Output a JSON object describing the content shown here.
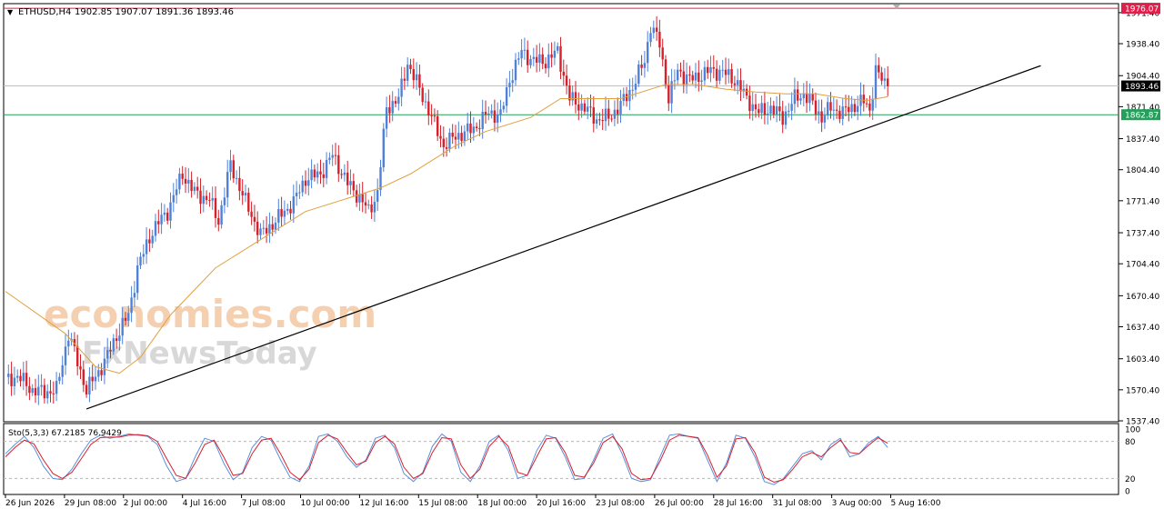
{
  "header": {
    "symbol_label": "ETHUSD,H4",
    "ohlc_text": "1902.85 1907.07 1891.36 1893.46",
    "dropdown_glyph": "▼"
  },
  "watermark": {
    "line1": "economies.com",
    "line2": "FxNewsToday"
  },
  "colors": {
    "bull": "#4f81d9",
    "bear": "#d6202a",
    "ma": "#e0a040",
    "trendline": "#000000",
    "resistance": "#e0204a",
    "support": "#23a05a",
    "current_price_bg": "#000000",
    "stoch_main": "#5b8fd8",
    "stoch_signal": "#d62030"
  },
  "chart_data": [
    {
      "type": "candlestick",
      "symbol": "ETHUSD",
      "timeframe": "H4",
      "y_ticks": [
        1971.4,
        1938.4,
        1904.4,
        1871.4,
        1837.4,
        1804.4,
        1771.4,
        1737.4,
        1704.4,
        1670.4,
        1637.4,
        1603.4,
        1570.4,
        1537.4
      ],
      "ylim": [
        1537.4,
        1980
      ],
      "x_ticks": [
        "26 Jun 2026",
        "29 Jun 08:00",
        "2 Jul 00:00",
        "4 Jul 16:00",
        "7 Jul 08:00",
        "10 Jul 00:00",
        "12 Jul 16:00",
        "15 Jul 08:00",
        "18 Jul 00:00",
        "20 Jul 16:00",
        "23 Jul 08:00",
        "26 Jul 00:00",
        "28 Jul 16:00",
        "31 Jul 08:00",
        "3 Aug 00:00",
        "5 Aug 16:00"
      ],
      "bar_count": 240,
      "anchors": [
        [
          0,
          1580
        ],
        [
          4,
          1585
        ],
        [
          9,
          1570
        ],
        [
          13,
          1568
        ],
        [
          17,
          1570
        ],
        [
          21,
          1630
        ],
        [
          24,
          1600
        ],
        [
          27,
          1570
        ],
        [
          30,
          1585
        ],
        [
          33,
          1600
        ],
        [
          37,
          1628
        ],
        [
          41,
          1650
        ],
        [
          44,
          1700
        ],
        [
          49,
          1740
        ],
        [
          54,
          1760
        ],
        [
          59,
          1800
        ],
        [
          63,
          1780
        ],
        [
          68,
          1772
        ],
        [
          71,
          1750
        ],
        [
          75,
          1810
        ],
        [
          80,
          1770
        ],
        [
          85,
          1735
        ],
        [
          90,
          1750
        ],
        [
          96,
          1770
        ],
        [
          100,
          1795
        ],
        [
          105,
          1800
        ],
        [
          109,
          1820
        ],
        [
          114,
          1790
        ],
        [
          118,
          1775
        ],
        [
          121,
          1760
        ],
        [
          124,
          1780
        ],
        [
          127,
          1870
        ],
        [
          131,
          1880
        ],
        [
          134,
          1918
        ],
        [
          138,
          1890
        ],
        [
          142,
          1860
        ],
        [
          146,
          1830
        ],
        [
          150,
          1840
        ],
        [
          156,
          1848
        ],
        [
          161,
          1865
        ],
        [
          165,
          1862
        ],
        [
          168,
          1900
        ],
        [
          172,
          1930
        ],
        [
          176,
          1920
        ],
        [
          180,
          1920
        ],
        [
          184,
          1930
        ],
        [
          188,
          1880
        ],
        [
          193,
          1870
        ],
        [
          197,
          1858
        ],
        [
          201,
          1860
        ],
        [
          205,
          1873
        ],
        [
          209,
          1893
        ],
        [
          213,
          1920
        ],
        [
          215,
          1958
        ],
        [
          218,
          1938
        ],
        [
          221,
          1880
        ],
        [
          224,
          1910
        ],
        [
          228,
          1900
        ],
        [
          232,
          1905
        ],
        [
          235,
          1910
        ],
        [
          239,
          1908
        ],
        [
          243,
          1900
        ],
        [
          247,
          1880
        ],
        [
          251,
          1865
        ],
        [
          255,
          1870
        ],
        [
          259,
          1860
        ],
        [
          263,
          1880
        ],
        [
          266,
          1885
        ],
        [
          268,
          1878
        ],
        [
          272,
          1860
        ],
        [
          275,
          1870
        ],
        [
          279,
          1865
        ],
        [
          283,
          1873
        ],
        [
          286,
          1877
        ],
        [
          288,
          1868
        ],
        [
          290,
          1910
        ],
        [
          292,
          1900
        ],
        [
          294,
          1893
        ]
      ],
      "moving_average": [
        [
          0,
          1675
        ],
        [
          20,
          1630
        ],
        [
          30,
          1595
        ],
        [
          38,
          1588
        ],
        [
          45,
          1605
        ],
        [
          55,
          1650
        ],
        [
          70,
          1700
        ],
        [
          85,
          1730
        ],
        [
          100,
          1760
        ],
        [
          115,
          1775
        ],
        [
          125,
          1785
        ],
        [
          135,
          1800
        ],
        [
          150,
          1830
        ],
        [
          160,
          1845
        ],
        [
          175,
          1860
        ],
        [
          185,
          1880
        ],
        [
          195,
          1880
        ],
        [
          205,
          1880
        ],
        [
          220,
          1895
        ],
        [
          230,
          1895
        ],
        [
          240,
          1890
        ],
        [
          250,
          1887
        ],
        [
          260,
          1885
        ],
        [
          270,
          1885
        ],
        [
          280,
          1880
        ],
        [
          287,
          1878
        ],
        [
          294,
          1882
        ]
      ],
      "trendline": [
        [
          27,
          1550
        ],
        [
          345,
          1915
        ]
      ],
      "horizontal_lines": [
        {
          "label": "1976.07",
          "price": 1976.07,
          "color_key": "resistance"
        },
        {
          "label": "1862.87",
          "price": 1862.87,
          "color_key": "support"
        }
      ],
      "current_price": {
        "label": "1893.46",
        "price": 1893.46
      }
    },
    {
      "type": "line",
      "title": "Sto(5,3,3) 67.2185 76.9429",
      "y_ticks": [
        100,
        80,
        20,
        0
      ],
      "ylim": [
        0,
        100
      ],
      "series": [
        {
          "color_key": "stoch_main",
          "values": [
            60,
            75,
            88,
            70,
            40,
            20,
            18,
            35,
            60,
            82,
            90,
            85,
            88,
            92,
            90,
            88,
            75,
            40,
            15,
            20,
            55,
            85,
            80,
            45,
            18,
            30,
            70,
            88,
            82,
            50,
            22,
            15,
            40,
            88,
            92,
            80,
            55,
            38,
            50,
            85,
            90,
            70,
            28,
            15,
            30,
            72,
            92,
            80,
            30,
            15,
            40,
            80,
            90,
            65,
            20,
            25,
            65,
            90,
            85,
            55,
            18,
            20,
            50,
            85,
            92,
            60,
            20,
            15,
            18,
            55,
            90,
            92,
            88,
            85,
            50,
            15,
            45,
            90,
            85,
            55,
            15,
            10,
            20,
            40,
            60,
            65,
            50,
            75,
            85,
            55,
            60,
            78,
            88,
            70
          ]
        },
        {
          "color_key": "stoch_signal",
          "values": [
            55,
            70,
            82,
            76,
            50,
            28,
            20,
            30,
            52,
            75,
            86,
            87,
            87,
            90,
            91,
            89,
            80,
            52,
            25,
            20,
            45,
            75,
            82,
            55,
            25,
            28,
            60,
            82,
            85,
            60,
            30,
            18,
            35,
            78,
            90,
            84,
            62,
            42,
            48,
            78,
            88,
            76,
            38,
            20,
            28,
            62,
            86,
            84,
            42,
            20,
            35,
            72,
            88,
            72,
            30,
            25,
            55,
            84,
            86,
            62,
            25,
            22,
            45,
            78,
            88,
            68,
            28,
            18,
            20,
            48,
            82,
            90,
            88,
            86,
            58,
            22,
            40,
            84,
            86,
            62,
            22,
            14,
            18,
            35,
            55,
            62,
            55,
            70,
            82,
            62,
            60,
            74,
            86,
            77
          ]
        }
      ]
    }
  ]
}
